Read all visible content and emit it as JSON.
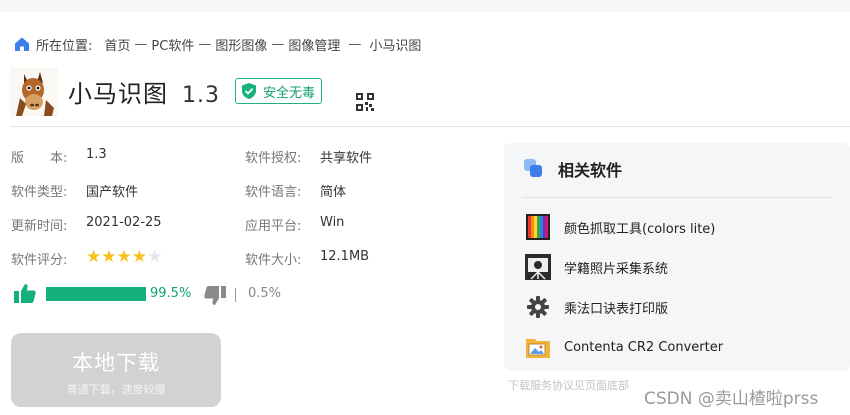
{
  "breadcrumb": {
    "prefix": "所在位置:",
    "items": [
      "首页",
      "PC软件",
      "图形图像",
      "图像管理",
      "小马识图"
    ],
    "separator": "—"
  },
  "software": {
    "name": "小马识图",
    "version": "1.3",
    "safe_badge": "安全无毒",
    "logo_icon": "horse-logo-icon",
    "qr_icon": "qr-code-icon"
  },
  "info": {
    "version_label": "版　　本:",
    "version_value": "1.3",
    "type_label": "软件类型:",
    "type_value": "国产软件",
    "updated_label": "更新时间:",
    "updated_value": "2021-02-25",
    "rating_label": "软件评分:",
    "rating_stars": 4,
    "rating_max": 5,
    "license_label": "软件授权:",
    "license_value": "共享软件",
    "language_label": "软件语言:",
    "language_value": "简体",
    "platform_label": "应用平台:",
    "platform_value": "Win",
    "size_label": "软件大小:",
    "size_value": "12.1MB"
  },
  "votes": {
    "up_percent_text": "99.5%",
    "up_fraction": 0.995,
    "down_percent_text": "0.5%"
  },
  "download": {
    "main_label": "本地下载",
    "sub_label": "普通下载，速度较慢"
  },
  "related": {
    "title": "相关软件",
    "items": [
      {
        "label": "颜色抓取工具(colors lite)",
        "icon": "color-bars-icon"
      },
      {
        "label": "学籍照片采集系统",
        "icon": "camera-icon"
      },
      {
        "label": "乘法口诀表打印版",
        "icon": "gear-icon"
      },
      {
        "label": "Contenta CR2 Converter",
        "icon": "folder-image-icon"
      }
    ]
  },
  "notice": "下载服务协议见页面底部",
  "watermark": "CSDN @卖山楂啦prss",
  "colors": {
    "accent_green": "#14b07c",
    "star_gold": "#f9c11b",
    "button_gray": "#d3d2d0",
    "home_blue": "#3d7eea"
  }
}
